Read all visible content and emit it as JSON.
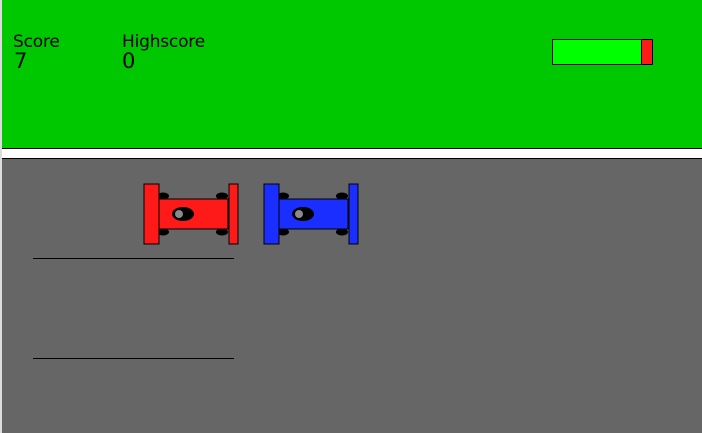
{
  "hud": {
    "score_label": "Score",
    "score_value": "7",
    "highscore_label": "Highscore",
    "highscore_value": "0"
  },
  "fuel": {
    "level": 0.9,
    "fill_color": "#00ff00",
    "empty_color": "#ff1a1a"
  },
  "colors": {
    "grass": "#00c800",
    "road": "#666666",
    "curb": "#ffffff",
    "player_car": "#ff1a1a",
    "rival_car": "#1a2eff"
  },
  "cars": [
    {
      "name": "red-car",
      "color": "#ff1a1a"
    },
    {
      "name": "blue-car",
      "color": "#1a2eff"
    }
  ]
}
